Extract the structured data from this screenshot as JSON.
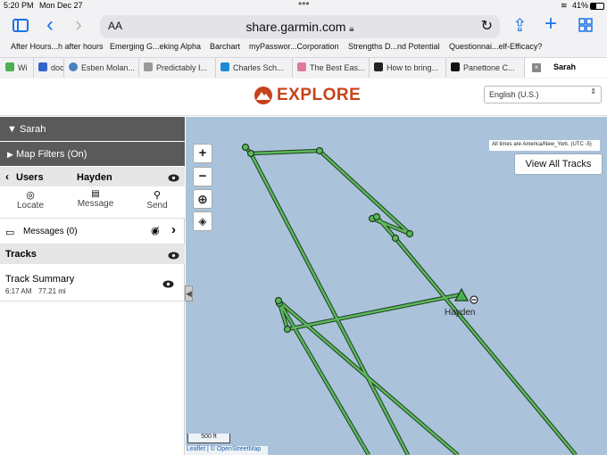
{
  "status": {
    "time": "5:20 PM",
    "date": "Mon Dec 27",
    "battery": "41%"
  },
  "browser": {
    "url": "share.garmin.com",
    "text_size": "AA",
    "bookmarks": [
      "After Hours...h after hours",
      "Emerging G...eking Alpha",
      "Barchart",
      "myPasswor...Corporation",
      "Strengths D...nd Potential",
      "Questionnai...elf-Efficacy?"
    ],
    "tabs": [
      "Wi",
      "doc",
      "Esben Molan...",
      "Predictably I...",
      "Charles Sch...",
      "The Best Eas...",
      "How to bring...",
      "Panettone C...",
      "Sarah"
    ]
  },
  "header": {
    "brand": "EXPLORE",
    "language": "English (U.S.)"
  },
  "sidebar": {
    "user_title": "Sarah",
    "map_filters": "Map Filters (On)",
    "users_label": "Users",
    "selected_user": "Hayden",
    "actions": [
      "Locate",
      "Message",
      "Send"
    ],
    "messages": "Messages (0)",
    "tracks_title": "Tracks",
    "track": {
      "name": "Track Summary",
      "time": "6:17 AM",
      "distance": "77.21 mi"
    }
  },
  "map": {
    "timezone_note": "All times are America/New_York. (UTC -5)",
    "view_all": "View All Tracks",
    "marker_label": "Hayden",
    "scale": "500 ft",
    "attribution": "Leaflet | © OpenStreetMap",
    "track_color": "#4caf50",
    "water_color": "#aac3db"
  }
}
